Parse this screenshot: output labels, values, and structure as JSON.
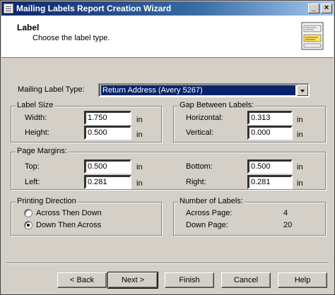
{
  "window": {
    "title": "Mailing Labels Report Creation Wizard",
    "minimize_label": "_",
    "close_label": "×"
  },
  "header": {
    "title": "Label",
    "subtitle": "Choose the label type.",
    "icon": "label-sheet-icon"
  },
  "label_type": {
    "label": "Mailing Label Type:",
    "selected": "Return Address (Avery 5267)"
  },
  "label_size": {
    "legend": "Label Size",
    "width_label": "Width:",
    "width_value": "1.750",
    "height_label": "Height:",
    "height_value": "0.500",
    "unit": "in"
  },
  "gap": {
    "legend": "Gap Between Labels:",
    "horizontal_label": "Horizontal:",
    "horizontal_value": "0.313",
    "vertical_label": "Vertical:",
    "vertical_value": "0.000",
    "unit": "in"
  },
  "margins": {
    "legend": "Page Margins:",
    "top_label": "Top:",
    "top_value": "0.500",
    "left_label": "Left:",
    "left_value": "0.281",
    "bottom_label": "Bottom:",
    "bottom_value": "0.500",
    "right_label": "Right:",
    "right_value": "0.281",
    "unit": "in"
  },
  "printing_direction": {
    "legend": "Printing Direction",
    "option1": "Across Then Down",
    "option2": "Down Then Across",
    "selected": "Down Then Across"
  },
  "number_of_labels": {
    "legend": "Number of Labels:",
    "across_label": "Across Page:",
    "across_value": "4",
    "down_label": "Down Page:",
    "down_value": "20"
  },
  "buttons": {
    "back": "< Back",
    "next": "Next >",
    "finish": "Finish",
    "cancel": "Cancel",
    "help": "Help"
  },
  "colors": {
    "titlebar": "#0a246a",
    "selection": "#0a246a",
    "face": "#d4d0c8"
  }
}
